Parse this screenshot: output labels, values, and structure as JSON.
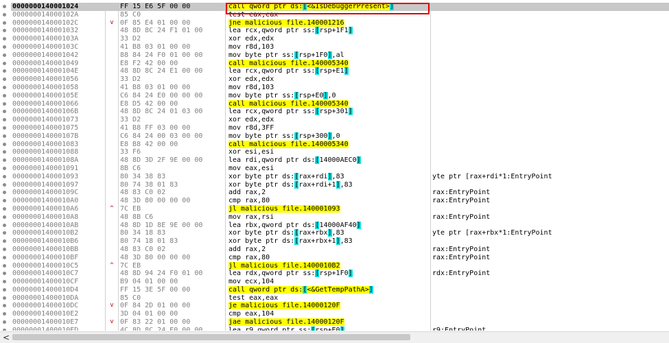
{
  "rows": [
    {
      "addr": "0000000140001024",
      "jmp": "",
      "bytes": "FF 15 E6 5F 00 00",
      "instr": "call qword ptr ds:[<&IsDebuggerPresent>]",
      "kind": "call",
      "comment": "",
      "selected": true
    },
    {
      "addr": "000000014000102A",
      "jmp": "",
      "bytes": "85 C0",
      "instr": "test eax,eax",
      "kind": "",
      "comment": ""
    },
    {
      "addr": "000000014000102C",
      "jmp": "v",
      "bytes": "0F 85 E4 01 00 00",
      "instr": "jne malicious file.140001216",
      "kind": "jmp",
      "comment": ""
    },
    {
      "addr": "0000000140001032",
      "jmp": "",
      "bytes": "48 8D 8C 24 F1 01 00",
      "instr": "lea rcx,qword ptr ss:[rsp+1F1]",
      "kind": "",
      "comment": ""
    },
    {
      "addr": "000000014000103A",
      "jmp": "",
      "bytes": "33 D2",
      "instr": "xor edx,edx",
      "kind": "",
      "comment": ""
    },
    {
      "addr": "000000014000103C",
      "jmp": "",
      "bytes": "41 B8 03 01 00 00",
      "instr": "mov r8d,103",
      "kind": "",
      "comment": ""
    },
    {
      "addr": "0000000140001042",
      "jmp": "",
      "bytes": "88 84 24 F0 01 00 00",
      "instr": "mov byte ptr ss:[rsp+1F0],al",
      "kind": "",
      "comment": ""
    },
    {
      "addr": "0000000140001049",
      "jmp": "",
      "bytes": "E8 F2 42 00 00",
      "instr": "call malicious file.140005340",
      "kind": "call",
      "comment": ""
    },
    {
      "addr": "000000014000104E",
      "jmp": "",
      "bytes": "48 8D 8C 24 E1 00 00",
      "instr": "lea rcx,qword ptr ss:[rsp+E1]",
      "kind": "",
      "comment": ""
    },
    {
      "addr": "0000000140001056",
      "jmp": "",
      "bytes": "33 D2",
      "instr": "xor edx,edx",
      "kind": "",
      "comment": ""
    },
    {
      "addr": "0000000140001058",
      "jmp": "",
      "bytes": "41 B8 03 01 00 00",
      "instr": "mov r8d,103",
      "kind": "",
      "comment": ""
    },
    {
      "addr": "000000014000105E",
      "jmp": "",
      "bytes": "C6 84 24 E0 00 00 00",
      "instr": "mov byte ptr ss:[rsp+E0],0",
      "kind": "",
      "comment": ""
    },
    {
      "addr": "0000000140001066",
      "jmp": "",
      "bytes": "E8 D5 42 00 00",
      "instr": "call malicious file.140005340",
      "kind": "call",
      "comment": ""
    },
    {
      "addr": "000000014000106B",
      "jmp": "",
      "bytes": "48 8D 8C 24 01 03 00",
      "instr": "lea rcx,qword ptr ss:[rsp+301]",
      "kind": "",
      "comment": ""
    },
    {
      "addr": "0000000140001073",
      "jmp": "",
      "bytes": "33 D2",
      "instr": "xor edx,edx",
      "kind": "",
      "comment": ""
    },
    {
      "addr": "0000000140001075",
      "jmp": "",
      "bytes": "41 B8 FF 03 00 00",
      "instr": "mov r8d,3FF",
      "kind": "",
      "comment": ""
    },
    {
      "addr": "000000014000107B",
      "jmp": "",
      "bytes": "C6 84 24 00 03 00 00",
      "instr": "mov byte ptr ss:[rsp+300],0",
      "kind": "",
      "comment": ""
    },
    {
      "addr": "0000000140001083",
      "jmp": "",
      "bytes": "E8 B8 42 00 00",
      "instr": "call malicious file.140005340",
      "kind": "call",
      "comment": ""
    },
    {
      "addr": "0000000140001088",
      "jmp": "",
      "bytes": "33 F6",
      "instr": "xor esi,esi",
      "kind": "",
      "comment": ""
    },
    {
      "addr": "000000014000108A",
      "jmp": "",
      "bytes": "48 8D 3D 2F 9E 00 00",
      "instr": "lea rdi,qword ptr ds:[14000AEC0]",
      "kind": "",
      "comment": ""
    },
    {
      "addr": "0000000140001091",
      "jmp": "",
      "bytes": "8B C6",
      "instr": "mov eax,esi",
      "kind": "",
      "comment": ""
    },
    {
      "addr": "0000000140001093",
      "jmp": "",
      "bytes": "80 34 38 83",
      "instr": "xor byte ptr ds:[rax+rdi],83",
      "kind": "",
      "comment": "yte ptr [rax+rdi*1:EntryPoint"
    },
    {
      "addr": "0000000140001097",
      "jmp": "",
      "bytes": "80 74 38 01 83",
      "instr": "xor byte ptr ds:[rax+rdi+1],83",
      "kind": "",
      "comment": ""
    },
    {
      "addr": "000000014000109C",
      "jmp": "",
      "bytes": "48 83 C0 02",
      "instr": "add rax,2",
      "kind": "",
      "comment": "rax:EntryPoint"
    },
    {
      "addr": "00000001400010A0",
      "jmp": "",
      "bytes": "48 3D 80 00 00 00",
      "instr": "cmp rax,80",
      "kind": "",
      "comment": "rax:EntryPoint"
    },
    {
      "addr": "00000001400010A6",
      "jmp": "^",
      "bytes": "7C EB",
      "instr": "jl malicious file.140001093",
      "kind": "jmp",
      "comment": ""
    },
    {
      "addr": "00000001400010A8",
      "jmp": "",
      "bytes": "48 8B C6",
      "instr": "mov rax,rsi",
      "kind": "",
      "comment": "rax:EntryPoint"
    },
    {
      "addr": "00000001400010AB",
      "jmp": "",
      "bytes": "48 8D 1D 8E 9E 00 00",
      "instr": "lea rbx,qword ptr ds:[14000AF40]",
      "kind": "",
      "comment": ""
    },
    {
      "addr": "00000001400010B2",
      "jmp": "",
      "bytes": "80 34 18 83",
      "instr": "xor byte ptr ds:[rax+rbx],83",
      "kind": "",
      "comment": "yte ptr [rax+rbx*1:EntryPoint"
    },
    {
      "addr": "00000001400010B6",
      "jmp": "",
      "bytes": "80 74 18 01 83",
      "instr": "xor byte ptr ds:[rax+rbx+1],83",
      "kind": "",
      "comment": ""
    },
    {
      "addr": "00000001400010BB",
      "jmp": "",
      "bytes": "48 83 C0 02",
      "instr": "add rax,2",
      "kind": "",
      "comment": "rax:EntryPoint"
    },
    {
      "addr": "00000001400010BF",
      "jmp": "",
      "bytes": "48 3D 80 00 00 00",
      "instr": "cmp rax,80",
      "kind": "",
      "comment": "rax:EntryPoint"
    },
    {
      "addr": "00000001400010C5",
      "jmp": "^",
      "bytes": "7C EB",
      "instr": "jl malicious file.1400010B2",
      "kind": "jmp",
      "comment": ""
    },
    {
      "addr": "00000001400010C7",
      "jmp": "",
      "bytes": "48 8D 94 24 F0 01 00",
      "instr": "lea rdx,qword ptr ss:[rsp+1F0]",
      "kind": "",
      "comment": "rdx:EntryPoint"
    },
    {
      "addr": "00000001400010CF",
      "jmp": "",
      "bytes": "B9 04 01 00 00",
      "instr": "mov ecx,104",
      "kind": "",
      "comment": ""
    },
    {
      "addr": "00000001400010D4",
      "jmp": "",
      "bytes": "FF 15 3E 5F 00 00",
      "instr": "call qword ptr ds:[<&GetTempPathA>]",
      "kind": "call",
      "comment": ""
    },
    {
      "addr": "00000001400010DA",
      "jmp": "",
      "bytes": "85 C0",
      "instr": "test eax,eax",
      "kind": "",
      "comment": ""
    },
    {
      "addr": "00000001400010DC",
      "jmp": "v",
      "bytes": "0F 84 2D 01 00 00",
      "instr": "je malicious file.14000120F",
      "kind": "jmp",
      "comment": ""
    },
    {
      "addr": "00000001400010E2",
      "jmp": "",
      "bytes": "3D 04 01 00 00",
      "instr": "cmp eax,104",
      "kind": "",
      "comment": ""
    },
    {
      "addr": "00000001400010E7",
      "jmp": "v",
      "bytes": "0F 83 22 01 00 00",
      "instr": "jae malicious file.14000120F",
      "kind": "jmp",
      "comment": ""
    },
    {
      "addr": "00000001400010ED",
      "jmp": "",
      "bytes": "4C 8D 8C 24 E0 00 00",
      "instr": "lea r9,qword ptr ss:[rsp+E0]",
      "kind": "",
      "comment": "r9:EntryPoint"
    }
  ],
  "scrollbar": {
    "left_arrow": "<"
  }
}
